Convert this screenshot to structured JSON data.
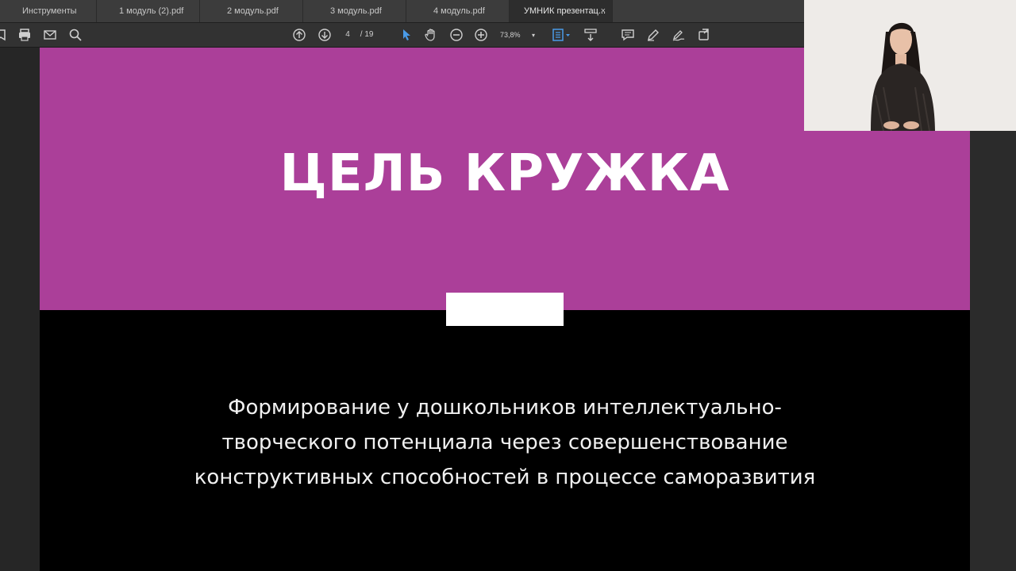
{
  "tabs": [
    {
      "label": "Инструменты",
      "active": false
    },
    {
      "label": "1 модуль (2).pdf",
      "active": false
    },
    {
      "label": "2 модуль.pdf",
      "active": false
    },
    {
      "label": "3 модуль.pdf",
      "active": false
    },
    {
      "label": "4 модуль.pdf",
      "active": false
    },
    {
      "label": "УМНИК презентац...",
      "active": true,
      "close": "×"
    }
  ],
  "toolbar": {
    "current_page": "4",
    "page_total": "/ 19",
    "zoom": "73,8%",
    "zoom_caret": "▾"
  },
  "slide": {
    "title": "ЦЕЛЬ КРУЖКА",
    "body_lines": [
      "Формирование у дошкольников интеллектуально-",
      "творческого потенциала через совершенствование",
      "конструктивных способностей в процессе саморазвития"
    ]
  },
  "colors": {
    "slide_accent": "#ab3f99",
    "slide_background": "#000000",
    "toolbar_background": "#323232",
    "select_tool_accent": "#4a9be8"
  },
  "icons": {
    "toolbar_left": [
      "print-icon",
      "email-icon",
      "zoom-search-icon"
    ],
    "navigation": [
      "page-up-icon",
      "page-down-icon"
    ],
    "tools": [
      "select-cursor-icon",
      "hand-icon",
      "zoom-out-icon",
      "zoom-in-icon",
      "fit-page-icon",
      "scroll-mode-icon"
    ],
    "toolbar_right": [
      "comment-icon",
      "highlight-pen-icon",
      "sign-icon",
      "share-icon"
    ]
  }
}
